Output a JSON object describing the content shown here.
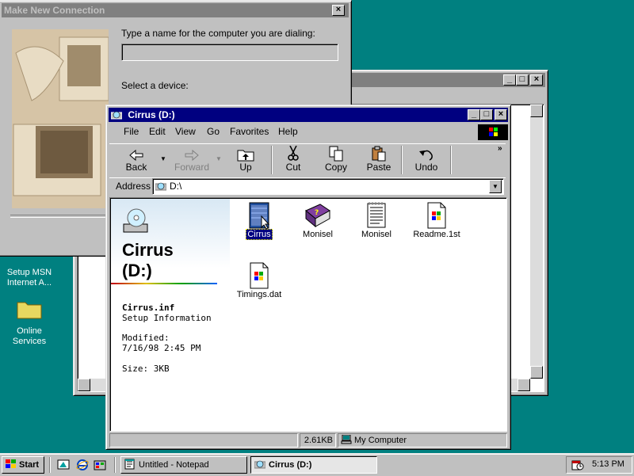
{
  "desktop": {
    "icons": [
      {
        "label": "Setup MSN Internet A..."
      },
      {
        "label": "Online Services"
      }
    ]
  },
  "dialog": {
    "title": "Make New Connection",
    "name_prompt": "Type a name for the computer you are dialing:",
    "name_value": "",
    "device_prompt": "Select a device:"
  },
  "explorer": {
    "title": "Cirrus (D:)",
    "menu": [
      "File",
      "Edit",
      "View",
      "Go",
      "Favorites",
      "Help"
    ],
    "toolbar": [
      {
        "label": "Back",
        "icon": "back-arrow-icon",
        "enabled": true
      },
      {
        "label": "Forward",
        "icon": "forward-arrow-icon",
        "enabled": false
      },
      {
        "label": "Up",
        "icon": "up-folder-icon",
        "enabled": true
      },
      {
        "label": "Cut",
        "icon": "scissors-icon",
        "enabled": true
      },
      {
        "label": "Copy",
        "icon": "copy-icon",
        "enabled": true
      },
      {
        "label": "Paste",
        "icon": "paste-icon",
        "enabled": true
      },
      {
        "label": "Undo",
        "icon": "undo-icon",
        "enabled": true
      }
    ],
    "address_label": "Address",
    "address_value": "D:\\",
    "webview": {
      "drive_title_line1": "Cirrus",
      "drive_title_line2": "(D:)",
      "selected_name": "Cirrus.inf",
      "selected_type": "Setup Information",
      "modified_label": "Modified:",
      "modified_value": "7/16/98 2:45 PM",
      "size_text": "Size: 3KB"
    },
    "files": [
      {
        "name": "Cirrus",
        "icon": "setup-info-icon",
        "selected": true
      },
      {
        "name": "Monisel",
        "icon": "help-book-icon",
        "selected": false
      },
      {
        "name": "Monisel",
        "icon": "text-document-icon",
        "selected": false
      },
      {
        "name": "Readme.1st",
        "icon": "windows-file-icon",
        "selected": false
      },
      {
        "name": "Timings.dat",
        "icon": "windows-file-icon",
        "selected": false
      }
    ],
    "status": {
      "size": "2.61KB",
      "location": "My Computer"
    }
  },
  "taskbar": {
    "start_label": "Start",
    "tasks": [
      {
        "label": "Untitled - Notepad",
        "active": false
      },
      {
        "label": "Cirrus (D:)",
        "active": true
      }
    ],
    "clock": "5:13 PM"
  },
  "colors": {
    "desktop": "#008080",
    "active_title": "#000080",
    "inactive_title": "#808080"
  }
}
